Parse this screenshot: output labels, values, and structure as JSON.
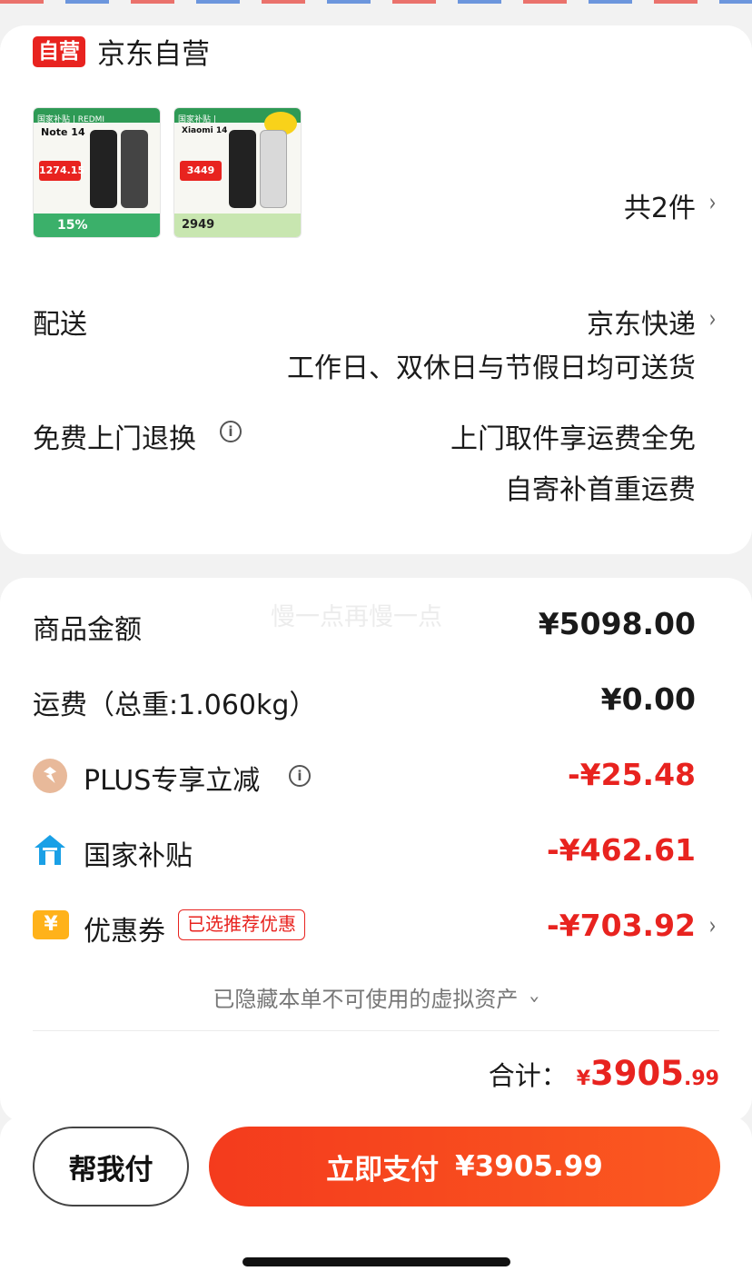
{
  "shop": {
    "badge": "自营",
    "name": "京东自营"
  },
  "products": [
    {
      "brand_strip": "国家补贴 | REDMI",
      "model": "Note 14",
      "price_tag": "1274.15",
      "discount": "15%"
    },
    {
      "brand_strip": "国家补贴 |",
      "model": "Xiaomi 14",
      "price_tag": "3449",
      "discount": "2949"
    }
  ],
  "item_count": "共2件",
  "delivery": {
    "label": "配送",
    "carrier": "京东快递",
    "schedule": "工作日、双休日与节假日均可送货"
  },
  "returns": {
    "label": "免费上门退换",
    "line1": "上门取件享运费全免",
    "line2": "自寄补首重运费"
  },
  "watermark": "慢一点再慢一点",
  "summary": {
    "goods_label": "商品金额",
    "goods_amount": "¥5098.00",
    "shipping_label": "运费（总重:1.060kg）",
    "shipping_amount": "¥0.00",
    "plus_label": "PLUS专享立减",
    "plus_amount": "-¥25.48",
    "subsidy_label": "国家补贴",
    "subsidy_amount": "-¥462.61",
    "coupon_label": "优惠券",
    "coupon_badge": "已选推荐优惠",
    "coupon_amount": "-¥703.92",
    "coupon_icon": "¥",
    "hidden_assets": "已隐藏本单不可使用的虚拟资产"
  },
  "total": {
    "label": "合计：",
    "symbol": "¥",
    "integer": "3905",
    "decimal": ".99"
  },
  "actions": {
    "help_pay": "帮我付",
    "pay_now": "立即支付",
    "pay_amount": "¥3905.99"
  },
  "colors": {
    "accent": "#e8231f",
    "pay_button": "#f43b1d"
  },
  "icons": [
    "info-icon",
    "plus-member-icon",
    "gov-subsidy-icon",
    "coupon-icon",
    "chevron-right-icon",
    "chevron-down-icon"
  ]
}
